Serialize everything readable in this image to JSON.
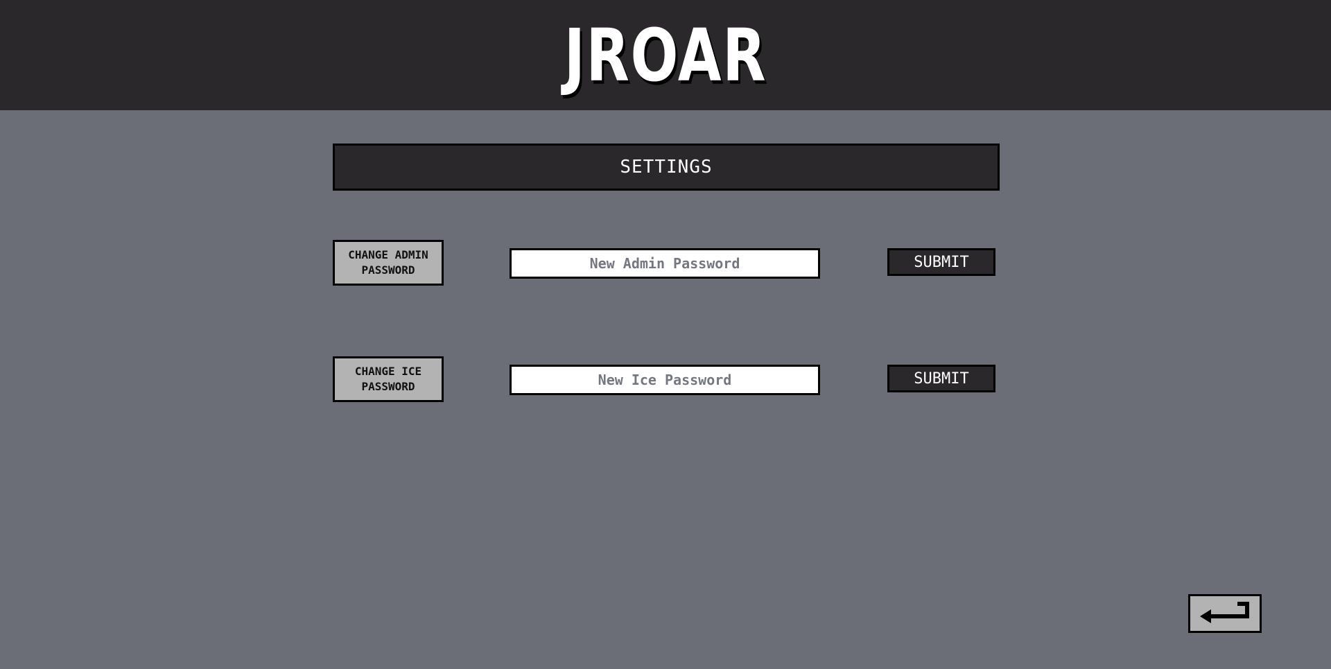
{
  "header": {
    "logo_text": "JROAR"
  },
  "page": {
    "title": "SETTINGS"
  },
  "rows": [
    {
      "label": "CHANGE ADMIN PASSWORD",
      "input_placeholder": "New Admin Password",
      "input_value": "",
      "submit_label": "SUBMIT"
    },
    {
      "label": "CHANGE ICE PASSWORD",
      "input_placeholder": "New Ice Password",
      "input_value": "",
      "submit_label": "SUBMIT"
    }
  ],
  "back_button": {
    "icon": "return-arrow-icon"
  },
  "colors": {
    "background": "#6b6e77",
    "header": "#2a282a",
    "label_button": "#b3b3b3",
    "border": "#000000",
    "text_light": "#ffffff"
  }
}
